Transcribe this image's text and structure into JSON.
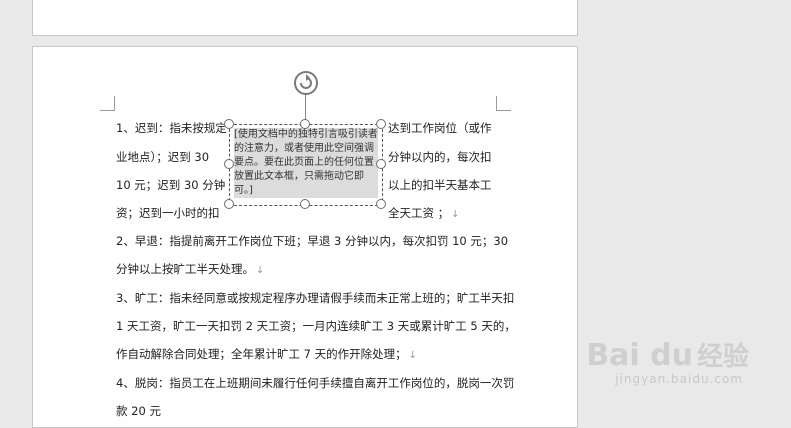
{
  "document": {
    "lines": [
      {
        "id": "p1-l1a",
        "text": "1、迟到：指未按规定"
      },
      {
        "id": "p1-l1b",
        "text": "达到工作岗位（或作"
      },
      {
        "id": "p1-l2a",
        "text": "业地点）；迟到 30"
      },
      {
        "id": "p1-l2b",
        "text": "分钟以内的，每次扣"
      },
      {
        "id": "p1-l3a",
        "text": "10 元；迟到 30 分钟"
      },
      {
        "id": "p1-l3b",
        "text": "以上的扣半天基本工"
      },
      {
        "id": "p1-l4a",
        "text": "资；迟到一小时的扣"
      },
      {
        "id": "p1-l4b",
        "text": "全天工资 ；"
      },
      {
        "id": "p2-l1",
        "text": "2、早退：指提前离开工作岗位下班；早退 3 分钟以内，每次扣罚 10 元；30"
      },
      {
        "id": "p2-l2",
        "text": "分钟以上按旷工半天处理。"
      },
      {
        "id": "p3-l1",
        "text": "3、旷工：指未经同意或按规定程序办理请假手续而未正常上班的；旷工半天扣"
      },
      {
        "id": "p3-l2",
        "text": "1 天工资，旷工一天扣罚 2 天工资；一月内连续旷工 3 天或累计旷工 5 天的，"
      },
      {
        "id": "p3-l3",
        "text": "作自动解除合同处理；全年累计旷工 7 天的作开除处理；"
      },
      {
        "id": "p4-l1",
        "text": "4、脱岗：指员工在上班期间未履行任何手续擅自离开工作岗位的，脱岗一次罚"
      },
      {
        "id": "p4-l2",
        "text": "款 20 元"
      }
    ],
    "paragraph_mark": "↓"
  },
  "textbox": {
    "text": "[使用文档中的独特引言吸引读者的注意力，或者使用此空间强调要点。要在此页面上的任何位置放置此文本框，只需拖动它即可。]"
  },
  "watermark": {
    "logo": "Bai du",
    "cn": "经验",
    "url": "jingyan.baidu.com"
  }
}
